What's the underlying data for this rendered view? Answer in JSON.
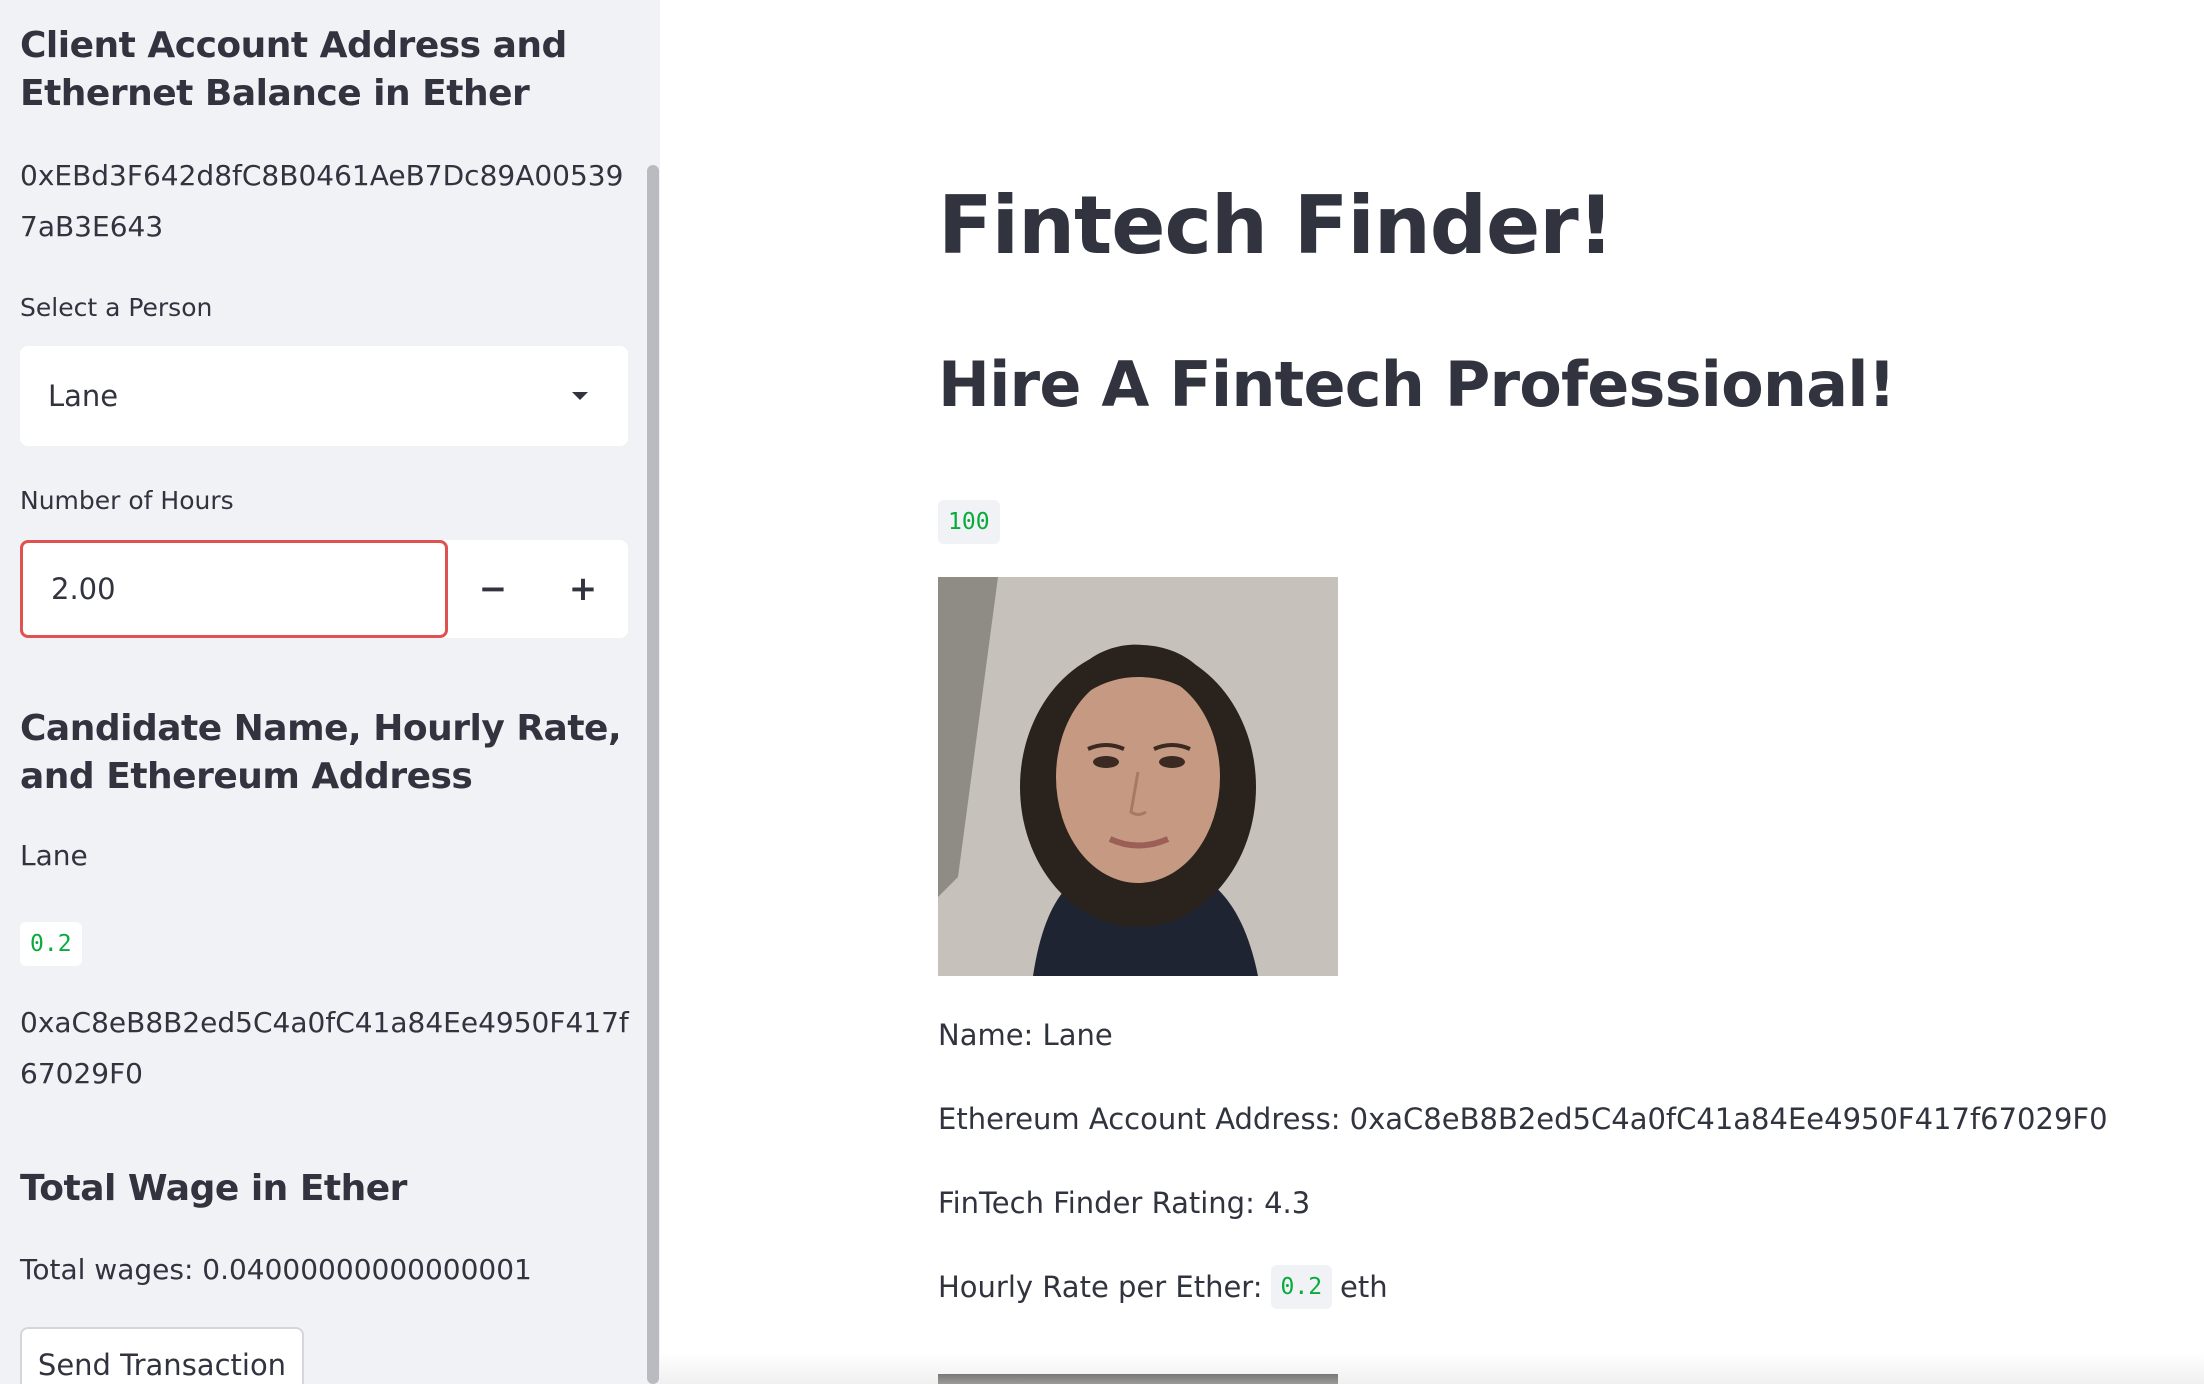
{
  "sidebar": {
    "account_heading": "Client Account Address and Ethernet Balance in Ether",
    "account_address": "0xEBd3F642d8fC8B0461AeB7Dc89A005397aB3E643",
    "select_label": "Select a Person",
    "selected_person": "Lane",
    "hours_label": "Number of Hours",
    "hours_value": "2.00",
    "minus_label": "−",
    "plus_label": "+",
    "candidate_heading": "Candidate Name, Hourly Rate, and Ethereum Address",
    "candidate_name": "Lane",
    "candidate_rate": "0.2",
    "candidate_address": "0xaC8eB8B2ed5C4a0fC41a84Ee4950F417f67029F0",
    "wage_heading": "Total Wage in Ether",
    "total_wages": "Total wages: 0.04000000000000001",
    "send_button": "Send Transaction"
  },
  "main": {
    "title": "Fintech Finder!",
    "subtitle": "Hire A Fintech Professional!",
    "code_value": "100",
    "name_line": "Name: Lane",
    "address_line": "Ethereum Account Address: 0xaC8eB8B2ed5C4a0fC41a84Ee4950F417f67029F0",
    "rating_line": "FinTech Finder Rating: 4.3",
    "rate_prefix": "Hourly Rate per Ether:",
    "rate_value": "0.2",
    "rate_suffix": "eth"
  },
  "colors": {
    "sidebar_bg": "#f0f2f6",
    "text": "#31333f",
    "code_green": "#09ab3b",
    "input_focus_border": "#e0524f"
  }
}
